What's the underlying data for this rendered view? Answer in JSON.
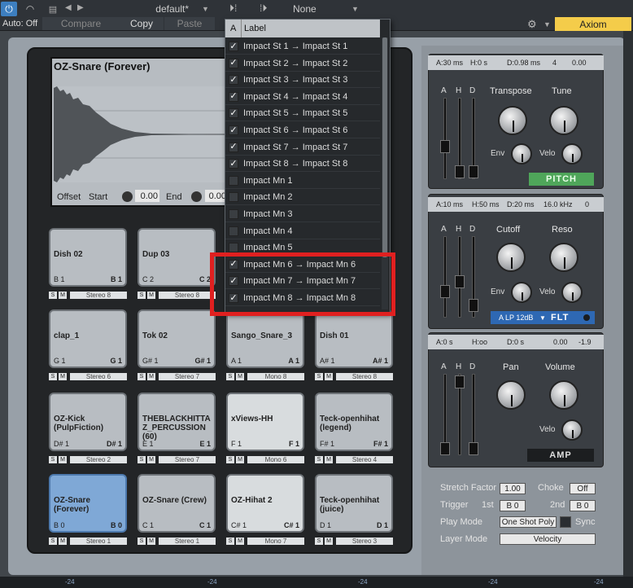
{
  "toolbar": {
    "auto_label": "Auto: Off",
    "preset_name": "default*",
    "compare_label": "Compare",
    "copy_label": "Copy",
    "paste_label": "Paste",
    "routing_value": "None",
    "device_name": "Axiom",
    "accent_color": "#3d7fc0",
    "device_color": "#f4cc4a"
  },
  "sample": {
    "title": "OZ-Snare (Forever)",
    "offset_label": "Offset",
    "start_label": "Start",
    "start_value": "0.00",
    "end_label": "End",
    "end_value": "0.00"
  },
  "pads": [
    {
      "name": "Dish 02",
      "note": "B 1",
      "note_right": "B 1",
      "channel": "Stereo 8",
      "style": "normal"
    },
    {
      "name": "Dup 03",
      "note": "C 2",
      "note_right": "C 2",
      "channel": "Stereo 8",
      "style": "normal"
    },
    {
      "name": "clap_1",
      "note": "G 1",
      "note_right": "G 1",
      "channel": "Stereo 6",
      "style": "normal"
    },
    {
      "name": "Tok 02",
      "note": "G# 1",
      "note_right": "G# 1",
      "channel": "Stereo 7",
      "style": "normal"
    },
    {
      "name": "Sango_Snare_3",
      "note": "A 1",
      "note_right": "A 1",
      "channel": "Mono 8",
      "style": "normal"
    },
    {
      "name": "Dish 01",
      "note": "A# 1",
      "note_right": "A# 1",
      "channel": "Stereo 8",
      "style": "normal"
    },
    {
      "name": "OZ-Kick (PulpFiction)",
      "note": "D# 1",
      "note_right": "D# 1",
      "channel": "Stereo 2",
      "style": "normal"
    },
    {
      "name": "THEBLACKHITTA Z_PERCUSSION (60)",
      "note": "E 1",
      "note_right": "E 1",
      "channel": "Stereo 7",
      "style": "normal"
    },
    {
      "name": "xViews-HH",
      "note": "F 1",
      "note_right": "F 1",
      "channel": "Mono 6",
      "style": "light"
    },
    {
      "name": "Teck-openhihat (legend)",
      "note": "F# 1",
      "note_right": "F# 1",
      "channel": "Stereo 4",
      "style": "normal"
    },
    {
      "name": "OZ-Snare (Forever)",
      "note": "B 0",
      "note_right": "B 0",
      "channel": "Stereo 1",
      "style": "blue"
    },
    {
      "name": "OZ-Snare (Crew)",
      "note": "C 1",
      "note_right": "C 1",
      "channel": "Stereo 1",
      "style": "normal"
    },
    {
      "name": "OZ-Hihat 2",
      "note": "C# 1",
      "note_right": "C# 1",
      "channel": "Mono 7",
      "style": "light"
    },
    {
      "name": "Teck-openhihat (juice)",
      "note": "D 1",
      "note_right": "D 1",
      "channel": "Stereo 3",
      "style": "normal"
    }
  ],
  "pad_buttons": {
    "solo": "S",
    "mute": "M"
  },
  "pitch": {
    "header": [
      "A:30 ms",
      "H:0 s",
      "D:0.98 ms",
      "4",
      "0.00"
    ],
    "env_labels": [
      "A",
      "H",
      "D"
    ],
    "transpose_label": "Transpose",
    "tune_label": "Tune",
    "env_label": "Env",
    "velo_label": "Velo",
    "button": "PITCH",
    "button_color": "#4fa65a"
  },
  "filter": {
    "header": [
      "A:10 ms",
      "H:50 ms",
      "D:20 ms",
      "16.0 kHz",
      "0"
    ],
    "env_labels": [
      "A",
      "H",
      "D"
    ],
    "cutoff_label": "Cutoff",
    "reso_label": "Reso",
    "env_label": "Env",
    "velo_label": "Velo",
    "type_value": "A LP 12dB",
    "button": "FLT",
    "button_color": "#2e68b3"
  },
  "amp": {
    "header": [
      "A:0 s",
      "H:oo",
      "D:0 s",
      "0.00",
      "-1.9"
    ],
    "env_labels": [
      "A",
      "H",
      "D"
    ],
    "pan_label": "Pan",
    "volume_label": "Volume",
    "velo_label": "Velo",
    "button": "AMP"
  },
  "properties": {
    "stretch_label": "Stretch Factor",
    "stretch_value": "1.00",
    "choke_label": "Choke",
    "choke_value": "Off",
    "trigger_label": "Trigger",
    "trigger_1st_label": "1st",
    "trigger_1st_value": "B 0",
    "trigger_2nd_label": "2nd",
    "trigger_2nd_value": "B 0",
    "playmode_label": "Play Mode",
    "playmode_value": "One Shot Poly",
    "sync_label": "Sync",
    "layermode_label": "Layer Mode",
    "layermode_value": "Velocity"
  },
  "dropdown": {
    "col_a": "A",
    "col_label": "Label",
    "items": [
      {
        "label": "Impact St 1 → Impact St 1",
        "checked": true
      },
      {
        "label": "Impact St 2 → Impact St 2",
        "checked": true
      },
      {
        "label": "Impact St 3 → Impact St 3",
        "checked": true
      },
      {
        "label": "Impact St 4 → Impact St 4",
        "checked": true
      },
      {
        "label": "Impact St 5 → Impact St 5",
        "checked": true
      },
      {
        "label": "Impact St 6 → Impact St 6",
        "checked": true
      },
      {
        "label": "Impact St 7 → Impact St 7",
        "checked": true
      },
      {
        "label": "Impact St 8 → Impact St 8",
        "checked": true
      },
      {
        "label": "Impact Mn 1",
        "checked": false
      },
      {
        "label": "Impact Mn 2",
        "checked": false
      },
      {
        "label": "Impact Mn 3",
        "checked": false
      },
      {
        "label": "Impact Mn 4",
        "checked": false
      },
      {
        "label": "Impact Mn 5",
        "checked": false
      },
      {
        "label": "Impact Mn 6 → Impact Mn 6",
        "checked": true
      },
      {
        "label": "Impact Mn 7 → Impact Mn 7",
        "checked": true
      },
      {
        "label": "Impact Mn 8 → Impact Mn 8",
        "checked": true
      }
    ],
    "highlight_color": "#e02020"
  },
  "bottom_strip": {
    "level": "-24"
  }
}
